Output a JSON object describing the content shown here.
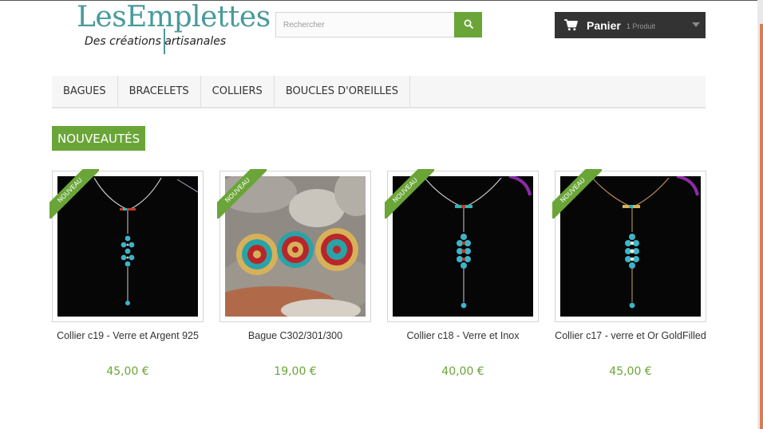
{
  "logo": {
    "main": "LesEmplettes",
    "tagline": "Des créations artisanales"
  },
  "search": {
    "placeholder": "Rechercher"
  },
  "cart": {
    "label": "Panier",
    "count": "1 Produit"
  },
  "menu": {
    "items": [
      {
        "label": "BAGUES"
      },
      {
        "label": "BRACELETS"
      },
      {
        "label": "COLLIERS"
      },
      {
        "label": "BOUCLES D'OREILLES"
      }
    ]
  },
  "section": {
    "title": "NOUVEAUTÉS"
  },
  "products": [
    {
      "name": "Collier c19 - Verre et Argent 925",
      "price": "45,00 €",
      "badge": "NOUVEAU"
    },
    {
      "name": "Bague C302/301/300",
      "price": "19,00 €",
      "badge": "NOUVEAU"
    },
    {
      "name": "Collier c18 - Verre et Inox",
      "price": "40,00 €",
      "badge": "NOUVEAU"
    },
    {
      "name": "Collier c17 - verre et Or GoldFilled",
      "price": "45,00 €",
      "badge": "NOUVEAU"
    }
  ],
  "colors": {
    "accent": "#6aa538",
    "cart_bg": "#333333",
    "logo": "#4a9a9c"
  },
  "icons": {
    "search": "search-icon",
    "cart": "shopping-cart-icon",
    "caret": "caret-down-icon"
  }
}
